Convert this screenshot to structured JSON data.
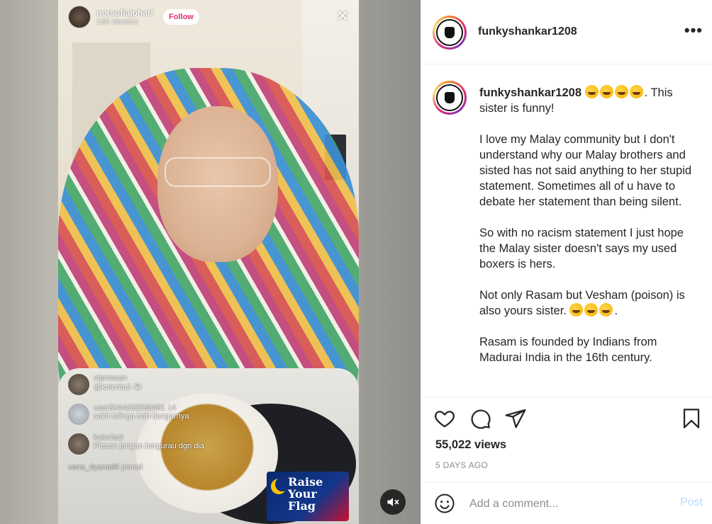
{
  "live": {
    "host_username": "norsufiajohari",
    "viewer_count": "166 viewers",
    "follow_label": "Follow",
    "close_icon": "close-icon",
    "comments": [
      {
        "name": "vipmesan",
        "message": "@kolorita3 😂"
      },
      {
        "name": "user3044032098491 14",
        "message": "sakit telinga bah dengarnya"
      },
      {
        "name": "kolorita3",
        "message": "Please jangan bergurau dgn dia"
      }
    ],
    "joined_user": "vana_dyana96",
    "joined_label": "joined",
    "badge": {
      "line1": "Raise",
      "line2": "Your Flag"
    },
    "mute_icon": "speaker-muted-icon"
  },
  "post": {
    "author": "funkyshankar1208",
    "more_icon": "more-horizontal-icon",
    "caption": {
      "username": "funkyshankar1208",
      "lead": ". This sister is funny!",
      "paragraphs": [
        "I love my Malay community but I don't understand why our Malay brothers and sisted has not said anything to her stupid statement. Sometimes all of u have to debate her statement than being silent.",
        "So with no racism statement I just hope the Malay sister doesn't says my used boxers is hers.",
        "Not only Rasam but Vesham (poison) is also yours sister.",
        "Rasam is founded by Indians from Madurai India in the 16th century."
      ],
      "para3_tail": "."
    },
    "views": "55,022 views",
    "time_ago": "5 DAYS AGO",
    "comment_placeholder": "Add a comment...",
    "post_label": "Post",
    "icons": {
      "like": "heart-icon",
      "comment": "comment-bubble-icon",
      "share": "paper-plane-icon",
      "save": "bookmark-icon",
      "emoji": "smiley-icon"
    },
    "colors": {
      "post_disabled": "#b3dbff",
      "meta_grey": "#8e8e8e",
      "text": "#262626",
      "follow_pink": "#e1306c"
    }
  }
}
